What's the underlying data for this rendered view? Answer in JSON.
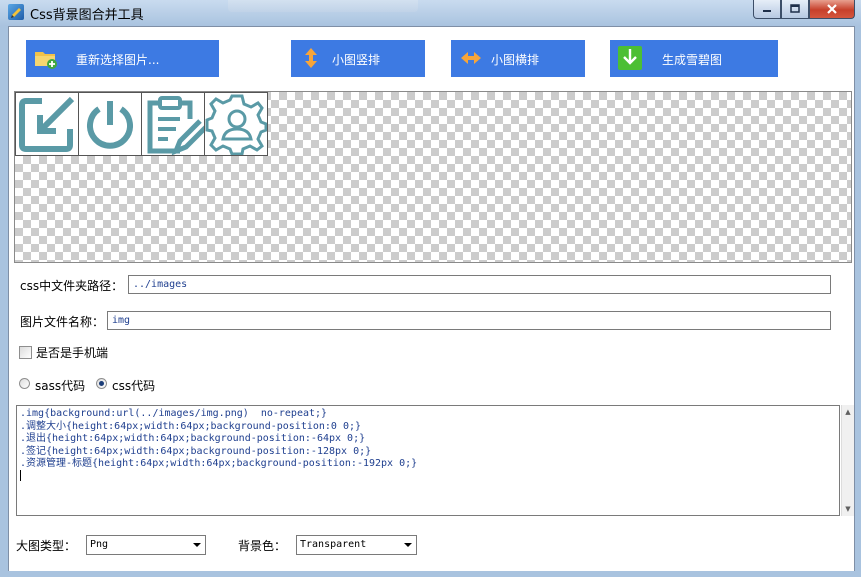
{
  "window": {
    "title": "Css背景图合并工具",
    "controls": [
      "minimize-icon",
      "maximize-icon",
      "close-icon"
    ]
  },
  "toolbar": {
    "reselect_label": "重新选择图片...",
    "vertical_label": "小图竖排",
    "horizontal_label": "小图横排",
    "generate_label": "生成雪碧图"
  },
  "preview": {
    "sprite_icons": [
      "resize-icon",
      "power-icon",
      "clipboard-edit-icon",
      "user-settings-icon"
    ],
    "icon_color": "#5a9aa6"
  },
  "form": {
    "css_folder_label": "css中文件夹路径：",
    "css_folder_value": "../images",
    "image_name_label": "图片文件名称：",
    "image_name_value": "img",
    "mobile_label": "是否是手机端",
    "mobile_checked": false,
    "radio_sass_label": "sass代码",
    "radio_css_label": "css代码",
    "selected_format": "css代码"
  },
  "code": {
    "lines": [
      ".img{background:url(../images/img.png)  no-repeat;}",
      ".调整大小{height:64px;width:64px;background-position:0 0;}",
      ".退出{height:64px;width:64px;background-position:-64px 0;}",
      ".签记{height:64px;width:64px;background-position:-128px 0;}",
      ".资源管理-标题{height:64px;width:64px;background-position:-192px 0;}"
    ]
  },
  "footer": {
    "image_type_label": "大图类型：",
    "image_type_value": "Png",
    "bg_color_label": "背景色：",
    "bg_color_value": "Transparent"
  },
  "colors": {
    "button_blue": "#3d7ae3",
    "code_text": "#1f3f8f"
  }
}
